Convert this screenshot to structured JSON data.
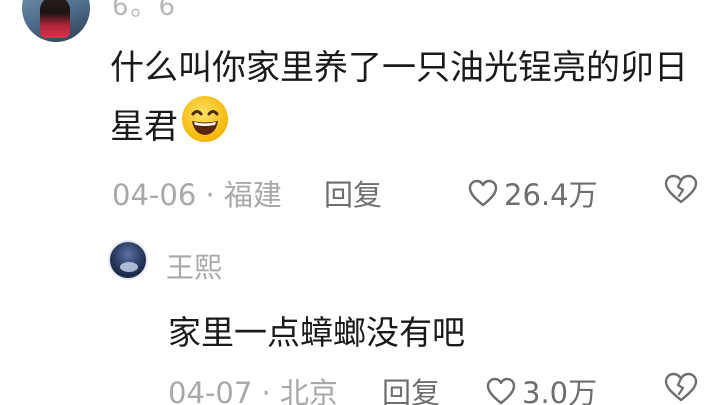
{
  "comment": {
    "username": "6。6",
    "text": "什么叫你家里养了一只油光锃亮的卯日星君",
    "emoji": "grinning-face-emoji",
    "date_location": "04-06 · 福建",
    "reply_label": "回复",
    "likes": "26.4万"
  },
  "reply": {
    "username": "王熙",
    "text": "家里一点蟑螂没有吧",
    "date_location": "04-07 · 北京",
    "reply_label": "回复",
    "likes": "3.0万"
  },
  "icons": {
    "like": "heart-outline-icon",
    "dislike": "broken-heart-outline-icon"
  },
  "colors": {
    "text_primary": "#1a1a1a",
    "text_secondary": "#a8a8a8",
    "text_action": "#6e6e6e",
    "background": "#ffffff"
  }
}
